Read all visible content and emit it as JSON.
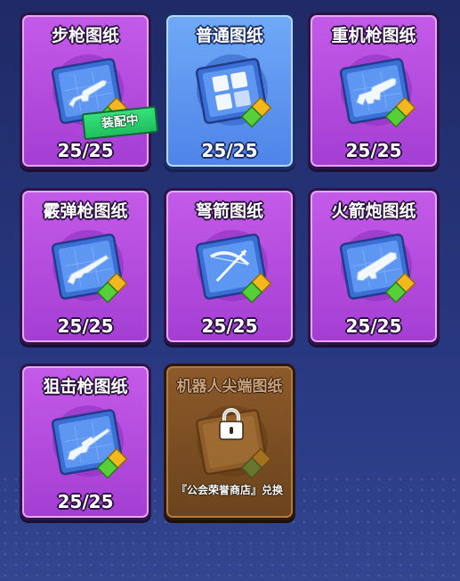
{
  "cards": [
    {
      "title": "步枪图纸",
      "count": "25/25",
      "style": "purple",
      "icon": "rifle-icon",
      "badge": "装配中"
    },
    {
      "title": "普通图纸",
      "count": "25/25",
      "style": "blue",
      "icon": "grid-blueprint-icon"
    },
    {
      "title": "重机枪图纸",
      "count": "25/25",
      "style": "purple",
      "icon": "heavy-machine-gun-icon"
    },
    {
      "title": "霰弹枪图纸",
      "count": "25/25",
      "style": "purple",
      "icon": "shotgun-icon"
    },
    {
      "title": "弩箭图纸",
      "count": "25/25",
      "style": "purple",
      "icon": "crossbow-icon"
    },
    {
      "title": "火箭炮图纸",
      "count": "25/25",
      "style": "purple",
      "icon": "rocket-launcher-icon"
    },
    {
      "title": "狙击枪图纸",
      "count": "25/25",
      "style": "purple",
      "icon": "sniper-rifle-icon"
    },
    {
      "title": "机器人尖端图纸",
      "style": "locked",
      "icon": "lock-icon",
      "lock_text": "『公会荣誉商店』兑换"
    }
  ],
  "colors": {
    "purple": "#b24be0",
    "blue": "#5b93ef",
    "locked": "#7a4d22",
    "badge": "#27cf69",
    "gem_gold": "#f2b81e",
    "gem_green": "#56cf3a"
  }
}
